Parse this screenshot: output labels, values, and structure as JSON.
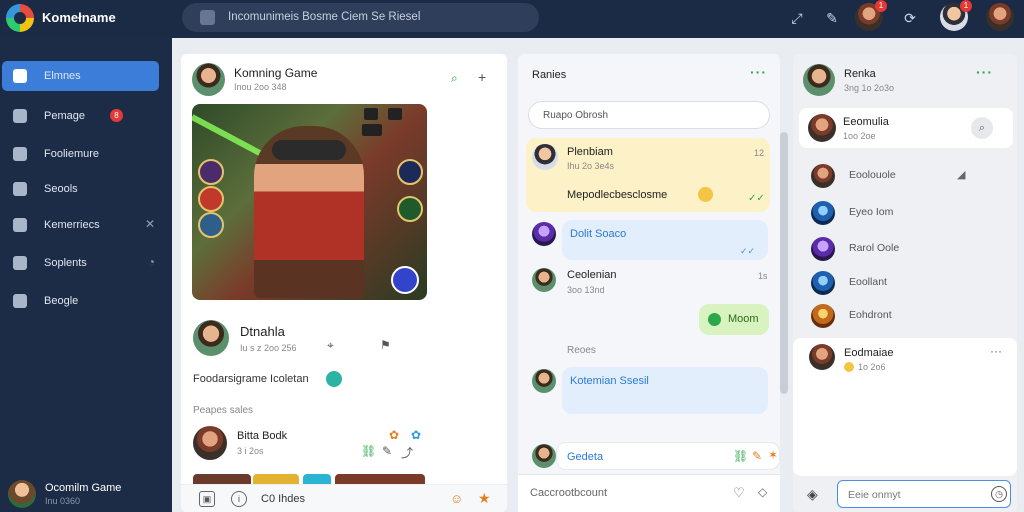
{
  "topbar": {
    "app_title": "Komełname",
    "search_placeholder": "Incomunimeis Bosme Ciem Se Riesel",
    "notification_count": "1",
    "message_count": "1"
  },
  "sidebar": {
    "items": [
      {
        "label": "Elmnes",
        "icon": "home-icon"
      },
      {
        "label": "Pemage",
        "icon": "message-icon",
        "badge": "8"
      },
      {
        "label": "Fooliemure",
        "icon": "store-icon"
      },
      {
        "label": "Seools",
        "icon": "tools-icon"
      },
      {
        "label": "Kemerriecs",
        "icon": "tag-icon"
      },
      {
        "label": "Soplents",
        "icon": "chart-icon"
      },
      {
        "label": "Beogle",
        "icon": "building-icon"
      }
    ],
    "footer": {
      "name": "Ocomilm Game",
      "sub": "Inu 0360"
    }
  },
  "feed": {
    "post_title": "Komning Game",
    "post_time": "Inou 2oo 348",
    "author_name": "Dtnahla",
    "author_time": "Iu s z 2oo 256",
    "caption": "Foodarsigrame Icoletan",
    "section_label": "Peapes sales",
    "comment_name": "Bitta Bodk",
    "comment_sub": "3 i 2os",
    "footer_label": "C0 Ihdes"
  },
  "chat": {
    "title": "Ranies",
    "search_placeholder": "Ruapo Obrosh",
    "messages": [
      {
        "name": "Plenbiam",
        "time": "Ihu 2o 3e4s",
        "text": "Mepodlecbesclosme",
        "stamp": "12"
      },
      {
        "name": "Dolit Soaco",
        "time": ""
      },
      {
        "name": "Ceolenian",
        "time": "3oo 13nd",
        "stamp": "1s"
      },
      {
        "name": "Moom"
      },
      {
        "divider": "Reoes"
      },
      {
        "name": "Kotemian Ssesil"
      },
      {
        "name": "Gedeta"
      }
    ],
    "input_placeholder": "Caccrootbcount"
  },
  "right": {
    "header_name": "Renka",
    "header_time": "3ng 1o 2o3o",
    "featured_name": "Eeomulia",
    "featured_time": "1oo 2oe",
    "contacts": [
      "Eoolouole",
      "Eyeo Iom",
      "Rarol Oole",
      "Eoollant",
      "Eohdront"
    ],
    "last_name": "Eodmaiae",
    "last_time": "1o 2o6",
    "input_placeholder": "Eeie onmyt"
  }
}
